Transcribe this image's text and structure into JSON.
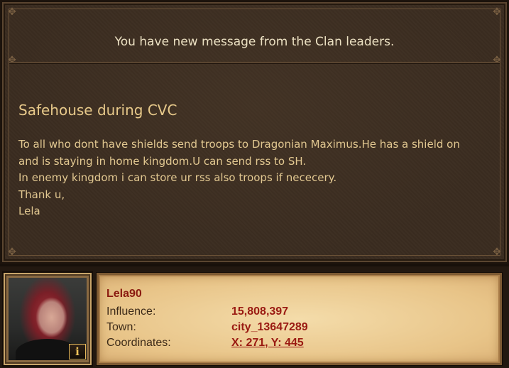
{
  "message": {
    "header": "You have new message from the Clan leaders.",
    "subject": "Safehouse during CVC",
    "body_lines": [
      "To all who dont have shields send troops to Dragonian Maximus.He has a shield on",
      "and is staying in home kingdom.U can send rss to SH.",
      "In enemy kingdom i can store ur rss also troops if nececery.",
      "Thank u,",
      "Lela"
    ]
  },
  "sender": {
    "name": "Lela90",
    "influence_label": "Influence:",
    "influence_value": "15,808,397",
    "town_label": "Town:",
    "town_value": "city_13647289",
    "coords_label": "Coordinates:",
    "coords_value": "X: 271, Y: 445",
    "info_button_label": "i"
  },
  "colors": {
    "panel_bg": "#3a2c20",
    "header_text": "#ebe0c2",
    "body_text": "#e2c891",
    "card_bg": "#e8c488",
    "name_red": "#8a1a10",
    "info_btn_border": "#e2b65a"
  },
  "icons": {
    "info": "info-icon",
    "corner": "ornament-corner-icon"
  }
}
